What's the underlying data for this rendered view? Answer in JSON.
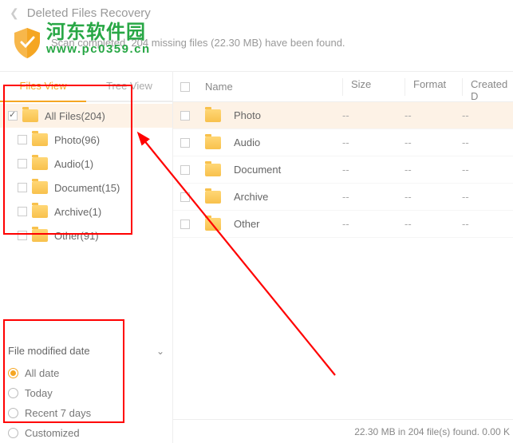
{
  "header": {
    "title": "Deleted Files Recovery",
    "status": "Scan completed. 204 missing files (22.30 MB) have been found."
  },
  "watermark": {
    "top": "河东软件园",
    "bottom": "www.pc0359.cn"
  },
  "tabs": {
    "files_view": "Files View",
    "tree_view": "Tree View"
  },
  "tree": {
    "root": "All Files(204)",
    "items": [
      {
        "label": "Photo(96)"
      },
      {
        "label": "Audio(1)"
      },
      {
        "label": "Document(15)"
      },
      {
        "label": "Archive(1)"
      },
      {
        "label": "Other(91)"
      }
    ]
  },
  "filter": {
    "title": "File modified date",
    "options": {
      "all": "All date",
      "today": "Today",
      "recent7": "Recent 7 days",
      "custom": "Customized"
    }
  },
  "table": {
    "headers": {
      "name": "Name",
      "size": "Size",
      "format": "Format",
      "created": "Created D"
    },
    "rows": [
      {
        "name": "Photo",
        "size": "--",
        "format": "--",
        "created": "--"
      },
      {
        "name": "Audio",
        "size": "--",
        "format": "--",
        "created": "--"
      },
      {
        "name": "Document",
        "size": "--",
        "format": "--",
        "created": "--"
      },
      {
        "name": "Archive",
        "size": "--",
        "format": "--",
        "created": "--"
      },
      {
        "name": "Other",
        "size": "--",
        "format": "--",
        "created": "--"
      }
    ]
  },
  "footer": {
    "status": "22.30 MB in 204 file(s) found. 0.00 K"
  }
}
